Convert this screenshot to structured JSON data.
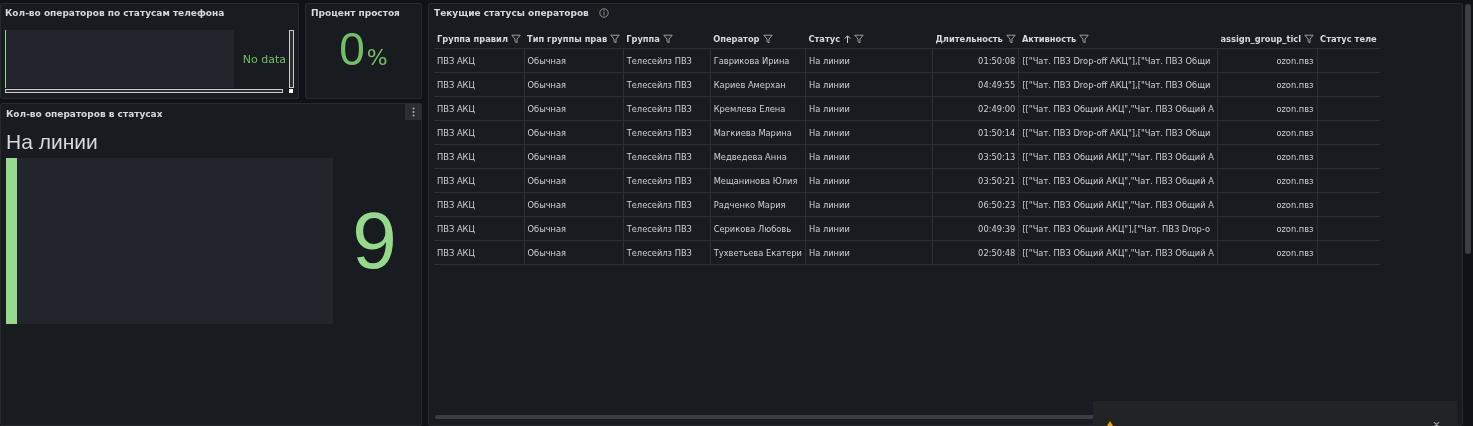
{
  "phone_status_panel": {
    "title": "Кол-во операторов по статусам телефона",
    "message": "No data"
  },
  "idle_panel": {
    "title": "Процент простоя",
    "value": "0",
    "unit": "%"
  },
  "status_count_panel": {
    "title": "Кол-во операторов в статусах",
    "bars": [
      {
        "label": "На линии",
        "value": "9",
        "level": 0.035,
        "color": "#96d98d"
      }
    ]
  },
  "table_panel": {
    "title": "Текущие статусы операторов",
    "columns": [
      {
        "label": "Группа правил",
        "sorted": false,
        "kind": "text"
      },
      {
        "label": "Тип группы прав",
        "sorted": false,
        "kind": "text"
      },
      {
        "label": "Группа",
        "sorted": false,
        "kind": "text"
      },
      {
        "label": "Оператор",
        "sorted": false,
        "kind": "text"
      },
      {
        "label": "Статус",
        "sorted": true,
        "kind": "text"
      },
      {
        "label": "Длительность",
        "sorted": false,
        "kind": "number"
      },
      {
        "label": "Активность",
        "sorted": false,
        "kind": "text"
      },
      {
        "label": "assign_group_ticl",
        "sorted": false,
        "kind": "number"
      },
      {
        "label": "Статус теле",
        "sorted": false,
        "kind": "text"
      }
    ],
    "rows": [
      [
        "ПВЗ АКЦ",
        "Обычная",
        "Телесейлз ПВЗ",
        "Гаврикова Ирина",
        "На линии",
        "01:50:08",
        "[[\"Чат. ПВЗ Drop-off АКЦ\"],[\"Чат. ПВЗ Общи",
        "ozon.пвз"
      ],
      [
        "ПВЗ АКЦ",
        "Обычная",
        "Телесейлз ПВЗ",
        "Кариев Амерхан",
        "На линии",
        "04:49:55",
        "[[\"Чат. ПВЗ Drop-off АКЦ\"],[\"Чат. ПВЗ Общи",
        "ozon.пвз"
      ],
      [
        "ПВЗ АКЦ",
        "Обычная",
        "Телесейлз ПВЗ",
        "Кремлева Елена",
        "На линии",
        "02:49:00",
        "[[\"Чат. ПВЗ Общий АКЦ\",\"Чат. ПВЗ Общий А",
        "ozon.пвз"
      ],
      [
        "ПВЗ АКЦ",
        "Обычная",
        "Телесейлз ПВЗ",
        "Магкиева Марина",
        "На линии",
        "01:50:14",
        "[[\"Чат. ПВЗ Drop-off АКЦ\"],[\"Чат. ПВЗ Общи",
        "ozon.пвз"
      ],
      [
        "ПВЗ АКЦ",
        "Обычная",
        "Телесейлз ПВЗ",
        "Медведева Анна",
        "На линии",
        "03:50:13",
        "[[\"Чат. ПВЗ Общий АКЦ\",\"Чат. ПВЗ Общий А",
        "ozon.пвз"
      ],
      [
        "ПВЗ АКЦ",
        "Обычная",
        "Телесейлз ПВЗ",
        "Мещанинова Юлия",
        "На линии",
        "03:50:21",
        "[[\"Чат. ПВЗ Общий АКЦ\",\"Чат. ПВЗ Общий А",
        "ozon.пвз"
      ],
      [
        "ПВЗ АКЦ",
        "Обычная",
        "Телесейлз ПВЗ",
        "Радченко Мария",
        "На линии",
        "06:50:23",
        "[[\"Чат. ПВЗ Общий АКЦ\",\"Чат. ПВЗ Общий А",
        "ozon.пвз"
      ],
      [
        "ПВЗ АКЦ",
        "Обычная",
        "Телесейлз ПВЗ",
        "Серикова Любовь",
        "На линии",
        "00:49:39",
        "[[\"Чат. ПВЗ Общий АКЦ\"],[\"Чат. ПВЗ Drop-o",
        "ozon.пвз"
      ],
      [
        "ПВЗ АКЦ",
        "Обычная",
        "Телесейлз ПВЗ",
        "Тухветьева Екатери",
        "На линии",
        "02:50:48",
        "[[\"Чат. ПВЗ Общий АКЦ\",\"Чат. ПВЗ Общий А",
        "ozon.пвз"
      ]
    ]
  }
}
